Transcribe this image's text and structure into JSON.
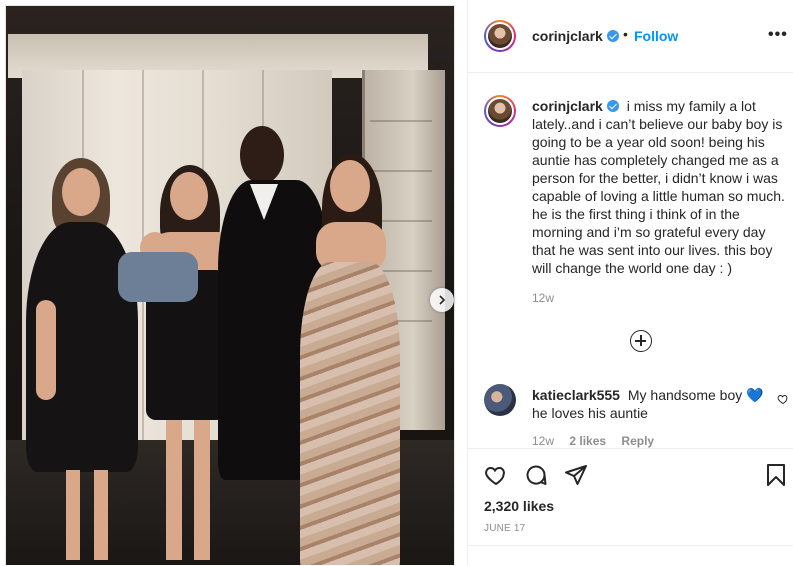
{
  "post": {
    "author": "corinjclark",
    "separator": "•",
    "follow_label": "Follow",
    "more_label": "•••"
  },
  "caption": {
    "author": "corinjclark",
    "text": "i miss my family a lot lately..and i can’t believe our baby boy is going to be a year old soon! being his auntie has completely changed me as a person for the better, i didn’t know i was capable of loving a little human so much. he is the first thing i think of in the morning and i’m so grateful every day that he was sent into our lives. this boy will change the world one day : )",
    "time": "12w"
  },
  "comment": {
    "author": "katieclark555",
    "text_before": "My handsome boy",
    "emoji": "💙",
    "text_after": "he loves his auntie",
    "time": "12w",
    "likes": "2 likes",
    "reply_label": "Reply"
  },
  "stats": {
    "likes": "2,320 likes",
    "date": "JUNE 17"
  },
  "colors": {
    "accent": "#0095f6",
    "verified": "#3897f0",
    "secondary_text": "#8e8e8e"
  },
  "icons": [
    "verified-badge-icon",
    "more-icon",
    "chevron-right-icon",
    "add-circle-icon",
    "heart-icon",
    "comment-icon",
    "share-icon",
    "bookmark-icon"
  ]
}
